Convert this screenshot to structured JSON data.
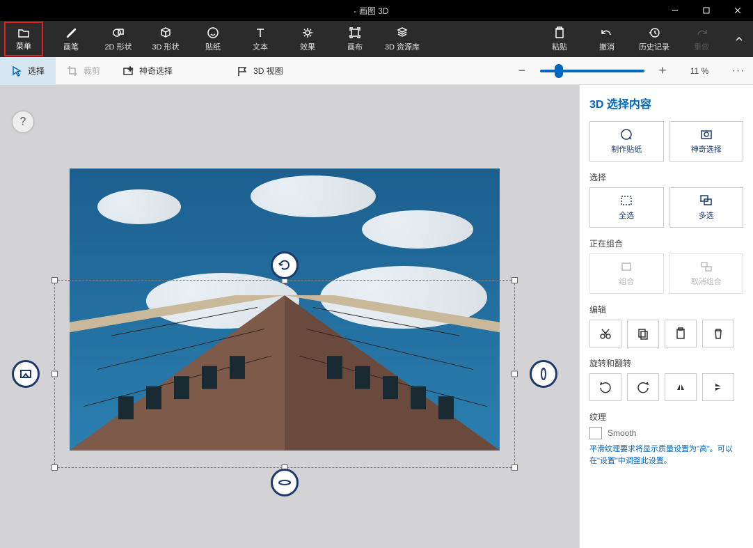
{
  "title": "- 画图 3D",
  "toolbar": {
    "menu": "菜单",
    "brush": "画笔",
    "shapes2d": "2D 形状",
    "shapes3d": "3D 形状",
    "stickers": "贴纸",
    "text": "文本",
    "effects": "效果",
    "canvas": "画布",
    "lib3d": "3D 资源库",
    "paste": "粘贴",
    "undo": "撤消",
    "history": "历史记录",
    "redo": "重做"
  },
  "subbar": {
    "select": "选择",
    "crop": "裁剪",
    "magic": "神奇选择",
    "view3d": "3D 视图",
    "zoom": "11 %"
  },
  "side": {
    "title": "3D 选择内容",
    "make_sticker": "制作贴纸",
    "magic_select": "神奇选择",
    "select_label": "选择",
    "select_all": "全选",
    "multi_select": "多选",
    "grouping_label": "正在组合",
    "group": "组合",
    "ungroup": "取消组合",
    "edit_label": "编辑",
    "rotate_label": "旋转和翻转",
    "texture_label": "纹理",
    "smooth": "Smooth",
    "hint": "平滑纹理要求将显示质量设置为\"高\"。可以在\"设置\"中调整此设置。"
  },
  "help_icon": "?"
}
